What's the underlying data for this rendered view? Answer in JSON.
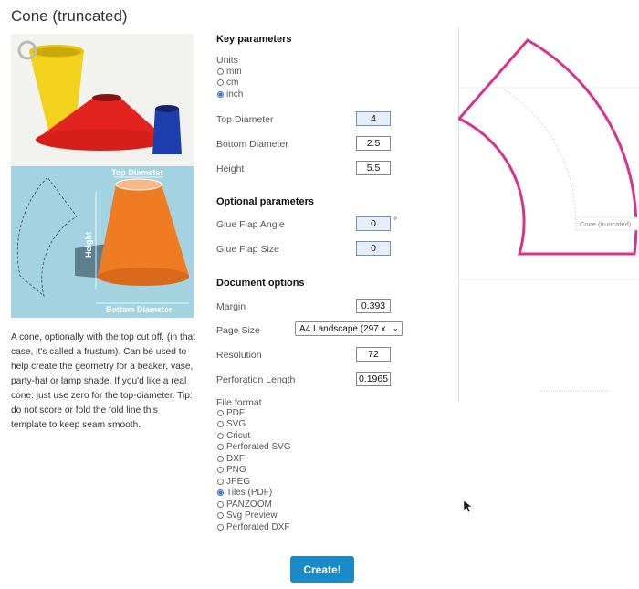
{
  "page": {
    "title": "Cone (truncated)"
  },
  "images": {
    "diagram_top_label": "Top Diameter",
    "diagram_side_label": "Height",
    "diagram_bottom_label": "Bottom Diameter"
  },
  "description": "A cone, optionally with the top cut off. (in that case, it's called a frustum). Can be used to help create the geometry for a beaker, vase, party-hat or lamp shade. If you'd like a real cone: just use zero for the top-diameter. Tip: do not score or fold the fold line this template to keep seam smooth.",
  "key_parameters": {
    "heading": "Key parameters",
    "units_label": "Units",
    "units": [
      {
        "label": "mm",
        "selected": false
      },
      {
        "label": "cm",
        "selected": false
      },
      {
        "label": "inch",
        "selected": true
      }
    ],
    "top_diameter": {
      "label": "Top Diameter",
      "value": "4"
    },
    "bottom_diameter": {
      "label": "Bottom Diameter",
      "value": "2.5"
    },
    "height": {
      "label": "Height",
      "value": "5.5"
    }
  },
  "optional_parameters": {
    "heading": "Optional parameters",
    "glue_flap_angle": {
      "label": "Glue Flap Angle",
      "value": "0",
      "unit": "°"
    },
    "glue_flap_size": {
      "label": "Glue Flap Size",
      "value": "0"
    }
  },
  "document_options": {
    "heading": "Document options",
    "margin": {
      "label": "Margin",
      "value": "0.393"
    },
    "page_size": {
      "label": "Page Size",
      "value": "A4 Landscape (297 x"
    },
    "resolution": {
      "label": "Resolution",
      "value": "72"
    },
    "perforation_length": {
      "label": "Perforation Length",
      "value": "0.1965"
    }
  },
  "file_format": {
    "label": "File format",
    "options": [
      {
        "label": "PDF",
        "selected": false
      },
      {
        "label": "SVG",
        "selected": false
      },
      {
        "label": "Cricut",
        "selected": false
      },
      {
        "label": "Perforated SVG",
        "selected": false
      },
      {
        "label": "DXF",
        "selected": false
      },
      {
        "label": "PNG",
        "selected": false
      },
      {
        "label": "JPEG",
        "selected": false
      },
      {
        "label": "Tiles (PDF)",
        "selected": true
      },
      {
        "label": "PANZOOM",
        "selected": false
      },
      {
        "label": "Svg Preview",
        "selected": false
      },
      {
        "label": "Perforated DXF",
        "selected": false
      }
    ]
  },
  "create_button": "Create!",
  "preview": {
    "label": "Cone (truncated)"
  },
  "colors": {
    "accent": "#1b8ac8",
    "template_outline": "#d6338f",
    "diagram_bg": "#a3d3e1"
  }
}
